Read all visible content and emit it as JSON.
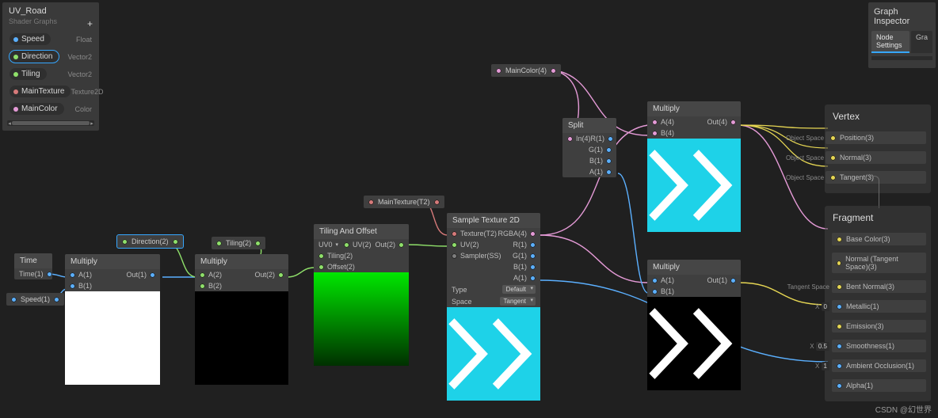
{
  "blackboard": {
    "title": "UV_Road",
    "subtitle": "Shader Graphs",
    "items": [
      {
        "label": "Speed",
        "type": "Float",
        "color": "#5bb0ff"
      },
      {
        "label": "Direction",
        "type": "Vector2",
        "color": "#8fe06a",
        "selected": true
      },
      {
        "label": "Tiling",
        "type": "Vector2",
        "color": "#8fe06a"
      },
      {
        "label": "MainTexture",
        "type": "Texture2D",
        "color": "#d77a7a"
      },
      {
        "label": "MainColor",
        "type": "Color",
        "color": "#e49ad6"
      }
    ]
  },
  "floats": {
    "direction": "Direction(2)",
    "tiling": "Tiling(2)",
    "maintex": "MainTexture(T2)",
    "maincolor": "MainColor(4)",
    "speed": "Speed(1)"
  },
  "time": {
    "title": "Time",
    "out": "Time(1)"
  },
  "multiply1": {
    "title": "Multiply",
    "a": "A(1)",
    "b": "B(1)",
    "out": "Out(1)"
  },
  "multiply2": {
    "title": "Multiply",
    "a": "A(2)",
    "b": "B(2)",
    "out": "Out(2)"
  },
  "tao": {
    "title": "Tiling And Offset",
    "uvlabel": "UV0",
    "uv": "UV(2)",
    "tiling": "Tiling(2)",
    "offset": "Offset(2)",
    "out": "Out(2)"
  },
  "sample": {
    "title": "Sample Texture 2D",
    "tex": "Texture(T2)",
    "uv": "UV(2)",
    "sampler": "Sampler(SS)",
    "rgba": "RGBA(4)",
    "r": "R(1)",
    "g": "G(1)",
    "b": "B(1)",
    "a": "A(1)",
    "type_lbl": "Type",
    "type_val": "Default",
    "space_lbl": "Space",
    "space_val": "Tangent"
  },
  "split": {
    "title": "Split",
    "in": "In(4)",
    "r": "R(1)",
    "g": "G(1)",
    "b": "B(1)",
    "a": "A(1)"
  },
  "multiply3": {
    "title": "Multiply",
    "a": "A(4)",
    "b": "B(4)",
    "out": "Out(4)"
  },
  "multiply4": {
    "title": "Multiply",
    "a": "A(1)",
    "b": "B(1)",
    "out": "Out(1)"
  },
  "inspector": {
    "title": "Graph Inspector",
    "tab1": "Node Settings",
    "tab2": "Gra"
  },
  "vertex": {
    "title": "Vertex",
    "os": "Object Space",
    "rows": [
      "Position(3)",
      "Normal(3)",
      "Tangent(3)"
    ]
  },
  "fragment": {
    "title": "Fragment",
    "ts": "Tangent Space",
    "rows": [
      {
        "label": "Base Color(3)"
      },
      {
        "label": "Normal (Tangent Space)(3)"
      },
      {
        "label": "Bent Normal(3)"
      },
      {
        "label": "Metallic(1)",
        "x": "X",
        "v": "0"
      },
      {
        "label": "Emission(3)"
      },
      {
        "label": "Smoothness(1)",
        "x": "X",
        "v": "0.5"
      },
      {
        "label": "Ambient Occlusion(1)",
        "x": "X",
        "v": "1"
      },
      {
        "label": "Alpha(1)"
      }
    ]
  },
  "watermark": "CSDN @幻世界"
}
